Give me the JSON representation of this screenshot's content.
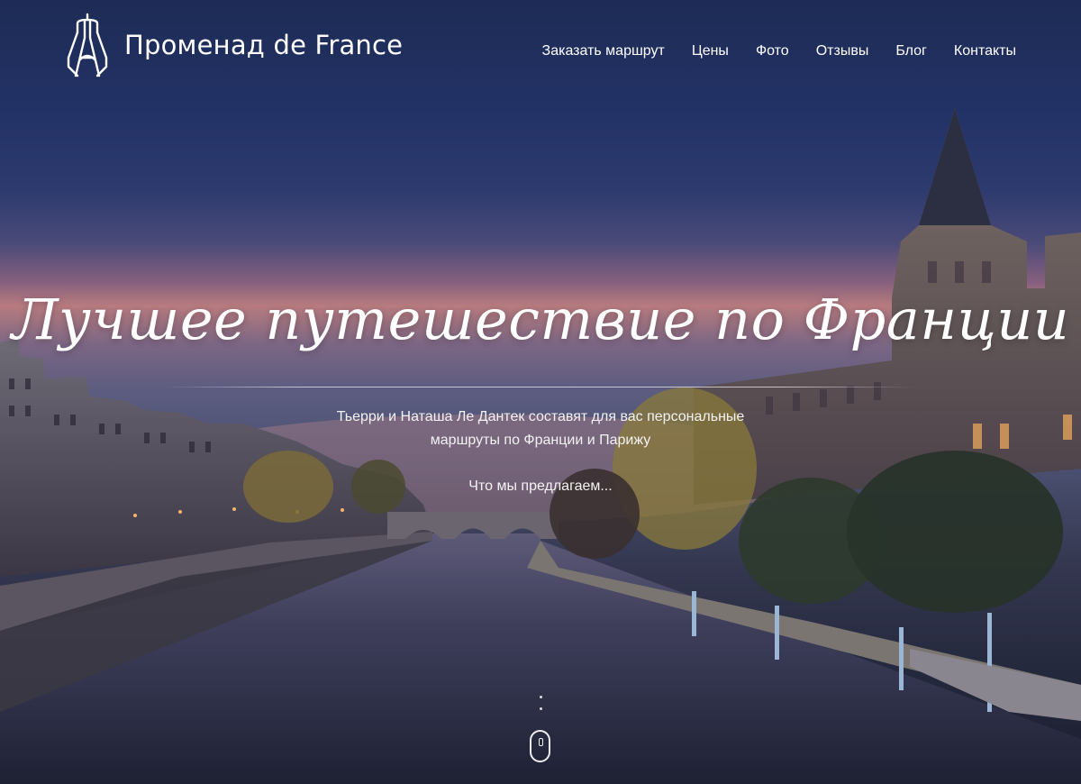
{
  "brand": {
    "name": "Променад de France",
    "logo_icon": "eiffel-tower-icon"
  },
  "nav": {
    "items": [
      {
        "label": "Заказать маршрут"
      },
      {
        "label": "Цены"
      },
      {
        "label": "Фото"
      },
      {
        "label": "Отзывы"
      },
      {
        "label": "Блог"
      },
      {
        "label": "Контакты"
      }
    ]
  },
  "hero": {
    "headline": "Лучшее путешествие по Франции",
    "subtitle_line1": "Тьерри и Наташа Ле Дантек составят для вас персональные",
    "subtitle_line2": "маршруты по Франции и Парижу",
    "offer_link": "Что мы предлагаем...",
    "scroll_icon": "mouse-scroll-icon"
  },
  "colors": {
    "text": "#ffffff",
    "sky_top": "#1d2b55",
    "sunset": "#b77b7f",
    "water": "#2a2d44"
  }
}
